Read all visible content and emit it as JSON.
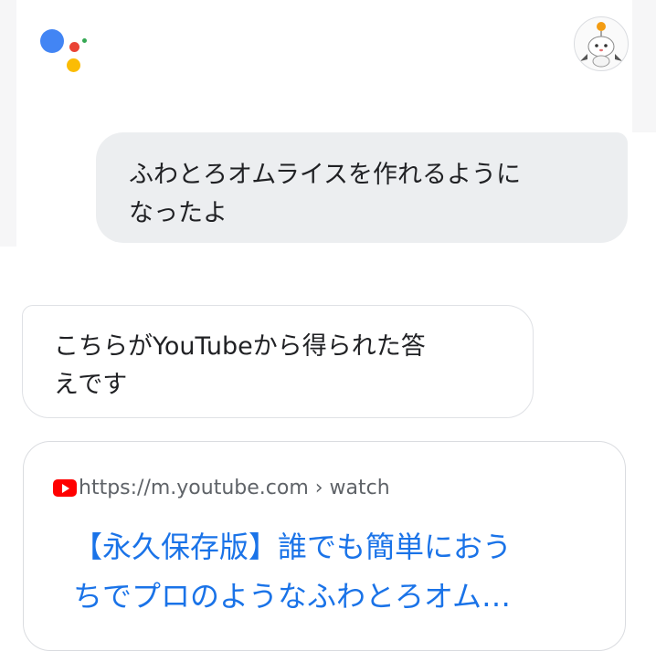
{
  "colors": {
    "assistant_blue": "#4285F4",
    "assistant_red": "#EA4335",
    "assistant_yellow": "#FBBC05",
    "assistant_green": "#34A853",
    "link_blue": "#1a73e8",
    "youtube_red": "#FF0000"
  },
  "header": {
    "logo_icon": "google-assistant-logo",
    "avatar_icon": "user-avatar"
  },
  "conversation": {
    "user_message": {
      "line1": "ふわとろオムライスを作れるように",
      "line2": "なったよ"
    },
    "assistant_message": {
      "line1": "こちらがYouTubeから得られた答",
      "line2": "えです"
    }
  },
  "result_card": {
    "source_icon": "youtube-icon",
    "source_url": "https://m.youtube.com › watch",
    "title_line1": "【永久保存版】誰でも簡単におう",
    "title_line2": "ちでプロのようなふわとろオム…"
  }
}
